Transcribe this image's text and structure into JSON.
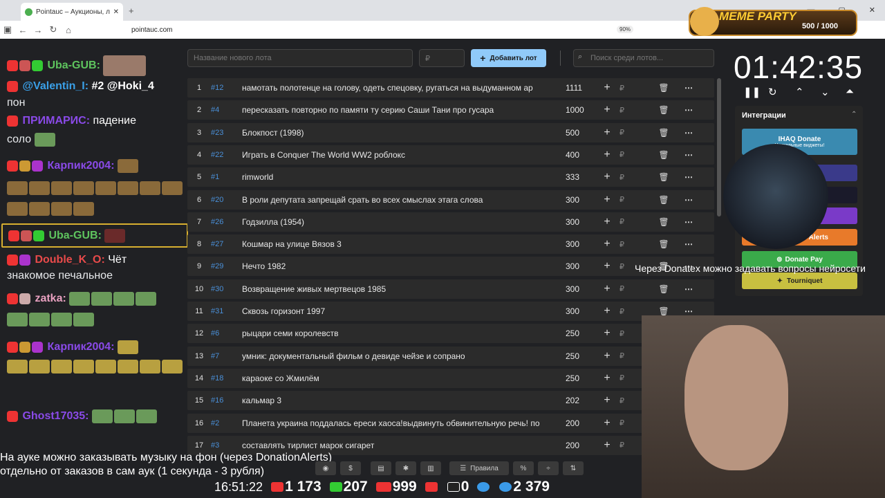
{
  "browser": {
    "tab_title": "Pointauc – Аукционы, лотереи",
    "url": "pointauc.com",
    "zoom": "90%"
  },
  "overlay": {
    "meme_title": "MEME PARTY",
    "meme_counter": "500 / 1000"
  },
  "chat": {
    "messages": [
      {
        "user": "Uba-GUB:",
        "text": "",
        "color": "#5ec45e"
      },
      {
        "user": "@Valentin_I:",
        "text": "#2 @Hoki_4",
        "color": "#3aa0e8"
      },
      {
        "user": "",
        "text": "пон",
        "color": "#fff"
      },
      {
        "user": "ПРИМАРИС:",
        "text": "падение",
        "color": "#8a4ae8"
      },
      {
        "user": "",
        "text": "соло",
        "color": "#fff"
      },
      {
        "user": "Карпик2004:",
        "text": "",
        "color": "#8a4ae8"
      },
      {
        "user": "Uba-GUB:",
        "text": "",
        "color": "#5ec45e"
      },
      {
        "user": "Double_K_O:",
        "text": "Чёт",
        "color": "#e84a4a"
      },
      {
        "user": "",
        "text": "знакомое печальное",
        "color": "#fff"
      },
      {
        "user": "zatka:",
        "text": "",
        "color": "#e8a0c0"
      },
      {
        "user": "Карпик2004:",
        "text": "",
        "color": "#8a4ae8"
      },
      {
        "user": "Ghost17035:",
        "text": "",
        "color": "#8a4ae8"
      }
    ]
  },
  "toolbar": {
    "new_lot_placeholder": "Название нового лота",
    "amount_placeholder": "₽",
    "add_label": "Добавить лот",
    "search_placeholder": "Поиск среди лотов..."
  },
  "lots": [
    {
      "n": "1",
      "id": "#12",
      "name": "намотать полотенце на голову, одеть спецовку, ругаться на выдуманном ар",
      "amount": "1111"
    },
    {
      "n": "2",
      "id": "#4",
      "name": "пересказать повторно по памяти ту серию Саши Тани про гусара",
      "amount": "1000"
    },
    {
      "n": "3",
      "id": "#23",
      "name": "Блокпост (1998)",
      "amount": "500"
    },
    {
      "n": "4",
      "id": "#22",
      "name": "Играть в Conquer The World WW2 роблокс",
      "amount": "400"
    },
    {
      "n": "5",
      "id": "#1",
      "name": "rimworld",
      "amount": "333"
    },
    {
      "n": "6",
      "id": "#20",
      "name": "В роли депутата запрещай срать во всех смыслах этага слова",
      "amount": "300"
    },
    {
      "n": "7",
      "id": "#26",
      "name": "Годзилла (1954)",
      "amount": "300"
    },
    {
      "n": "8",
      "id": "#27",
      "name": "Кошмар на улице Вязов 3",
      "amount": "300"
    },
    {
      "n": "9",
      "id": "#29",
      "name": "Нечто 1982",
      "amount": "300"
    },
    {
      "n": "10",
      "id": "#30",
      "name": "Возвращение живых мертвецов 1985",
      "amount": "300"
    },
    {
      "n": "11",
      "id": "#31",
      "name": "Сквозь горизонт 1997",
      "amount": "300"
    },
    {
      "n": "12",
      "id": "#6",
      "name": "рыцари семи королевств",
      "amount": "250"
    },
    {
      "n": "13",
      "id": "#7",
      "name": "умник: документальный фильм о девиде чейзе и сопрано",
      "amount": "250"
    },
    {
      "n": "14",
      "id": "#18",
      "name": "караоке со Жмилём",
      "amount": "250"
    },
    {
      "n": "15",
      "id": "#16",
      "name": "кальмар 3",
      "amount": "202"
    },
    {
      "n": "16",
      "id": "#2",
      "name": "Планета украина поддалась ереси хаоса!выдвинуть обвинительную речь! по",
      "amount": "200"
    },
    {
      "n": "17",
      "id": "#3",
      "name": "составлять тирлист марок сигарет",
      "amount": "200"
    }
  ],
  "timer": {
    "value": "01:42:35"
  },
  "integrations": {
    "title": "Интеграции",
    "ihaq": "IHAQ Donate",
    "ihaq_sub": "Уникальные виджеты!",
    "alerts": "Alerts",
    "donatepay": "Donate Pay",
    "tourniquet": "Tourniquet"
  },
  "captions": {
    "donatex": "Через Donatex можно задавать вопросы нейросети",
    "line1": "На ауке можно заказывать музыку на фон (через DonationAlerts)",
    "line2": "отдельно от заказов в сам аук (1 секунда - 3 рубля)"
  },
  "bottom_toolbar": {
    "rules_label": "Правила"
  },
  "stats": {
    "clock": "16:51:22",
    "youtube": "1 173",
    "kick": "207",
    "live": "999",
    "rutube": "0",
    "telegram": "2 379"
  }
}
